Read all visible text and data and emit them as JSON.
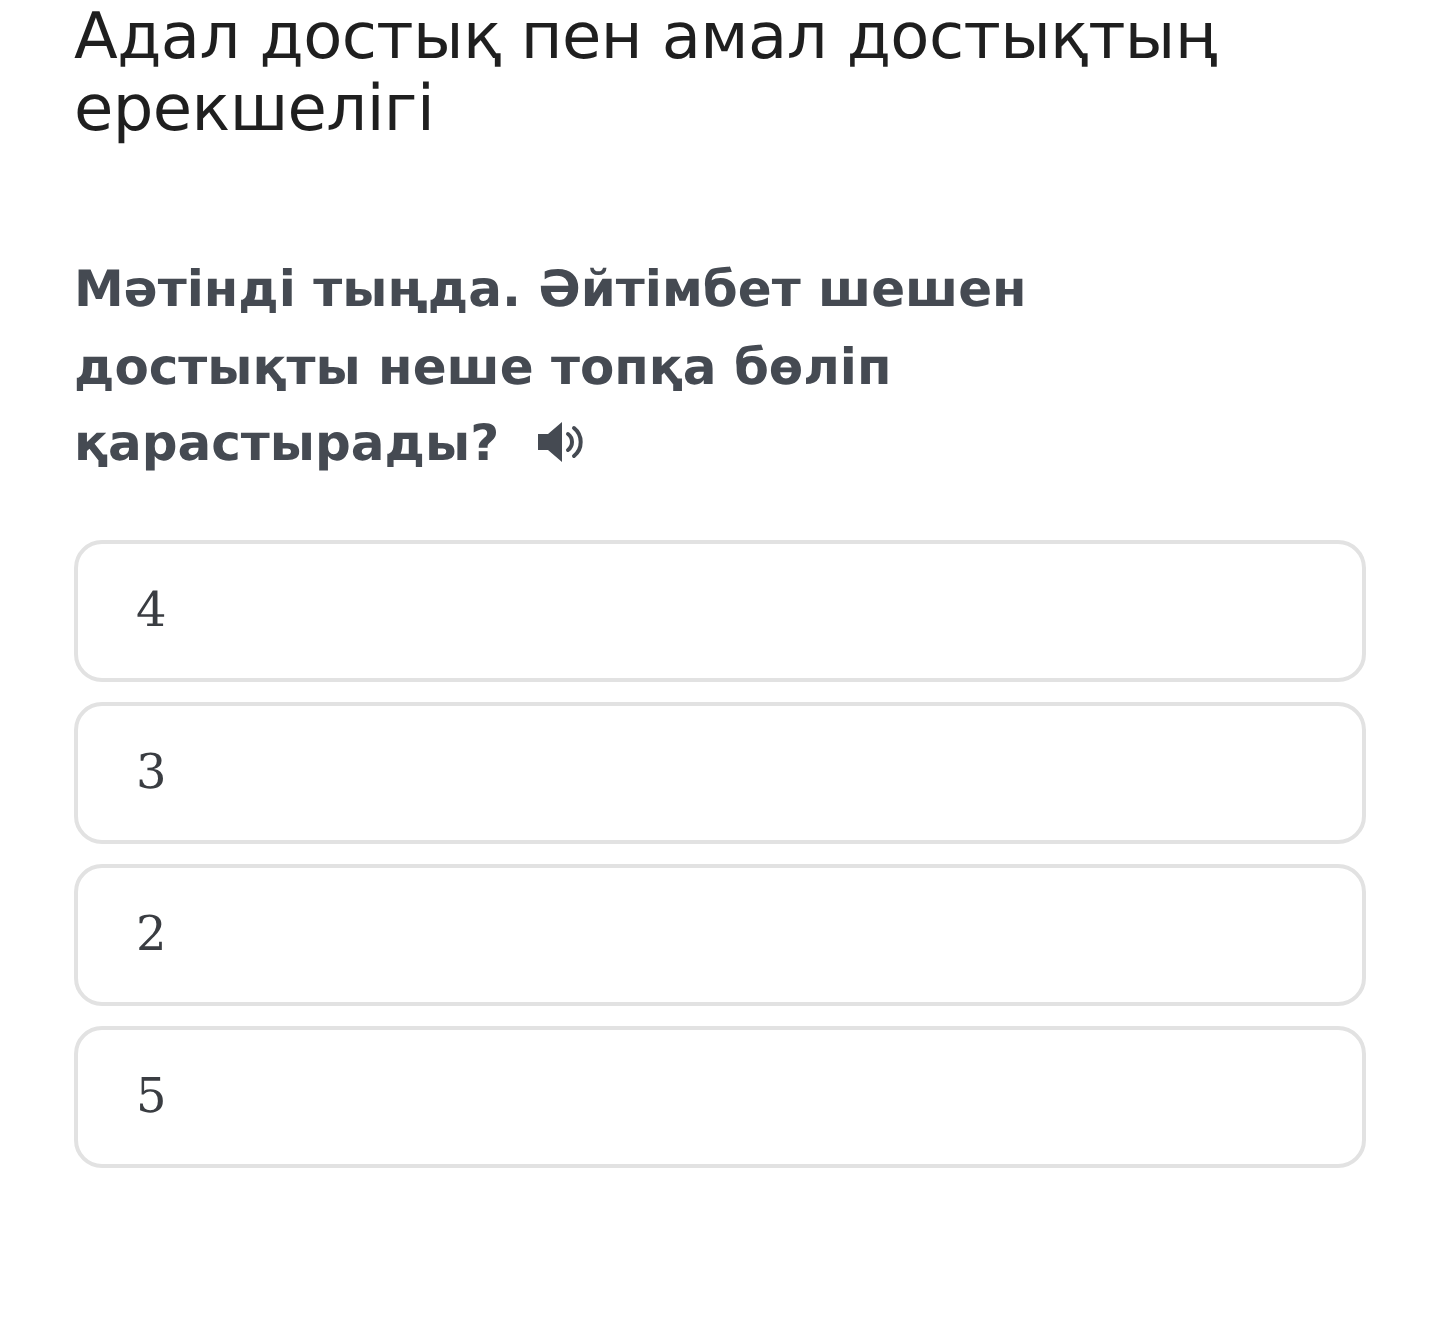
{
  "title": "Адал достық пен амал достықтың ерекшелігі",
  "question": {
    "text": "Мәтінді тыңда. Әйтімбет шешен достықты неше топқа бөліп қарастырады?"
  },
  "options": [
    {
      "label": "4"
    },
    {
      "label": "3"
    },
    {
      "label": "2"
    },
    {
      "label": "5"
    }
  ]
}
